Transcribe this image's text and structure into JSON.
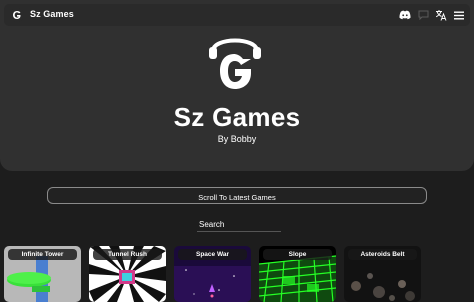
{
  "nav": {
    "title": "Sz Games",
    "icons": [
      "discord-icon",
      "chat-icon",
      "translate-icon",
      "menu-icon"
    ]
  },
  "hero": {
    "title": "Sz Games",
    "subtitle": "By Bobby"
  },
  "scroll_button": {
    "label": "Scroll To Latest Games"
  },
  "search": {
    "placeholder": "Search"
  },
  "games": [
    {
      "title": "Infinite Tower"
    },
    {
      "title": "Tunnel Rush"
    },
    {
      "title": "Space War"
    },
    {
      "title": "Slope"
    },
    {
      "title": "Asteroids Belt"
    }
  ],
  "colors": {
    "background": "#1d1d1d",
    "hero": "#303030",
    "navbar": "#2a2a2a",
    "text": "#ffffff"
  }
}
